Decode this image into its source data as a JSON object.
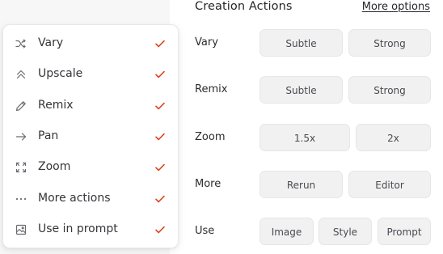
{
  "panel": {
    "title": "Creation Actions",
    "more_options": "More options",
    "rows": [
      {
        "label": "Vary",
        "buttons": [
          "Subtle",
          "Strong"
        ]
      },
      {
        "label": "Remix",
        "buttons": [
          "Subtle",
          "Strong"
        ]
      },
      {
        "label": "Zoom",
        "buttons": [
          "1.5x",
          "2x"
        ]
      },
      {
        "label": "More",
        "buttons": [
          "Rerun",
          "Editor"
        ]
      },
      {
        "label": "Use",
        "buttons": [
          "Image",
          "Style",
          "Prompt"
        ]
      }
    ]
  },
  "menu": {
    "check_color": "#e2401b",
    "items": [
      {
        "label": "Vary",
        "icon": "shuffle-icon",
        "checked": true
      },
      {
        "label": "Upscale",
        "icon": "double-chevron-up-icon",
        "checked": true
      },
      {
        "label": "Remix",
        "icon": "pencil-icon",
        "checked": true
      },
      {
        "label": "Pan",
        "icon": "arrow-right-icon",
        "checked": true
      },
      {
        "label": "Zoom",
        "icon": "expand-icon",
        "checked": true
      },
      {
        "label": "More actions",
        "icon": "ellipsis-icon",
        "checked": true
      },
      {
        "label": "Use in prompt",
        "icon": "image-frame-icon",
        "checked": true
      }
    ]
  }
}
